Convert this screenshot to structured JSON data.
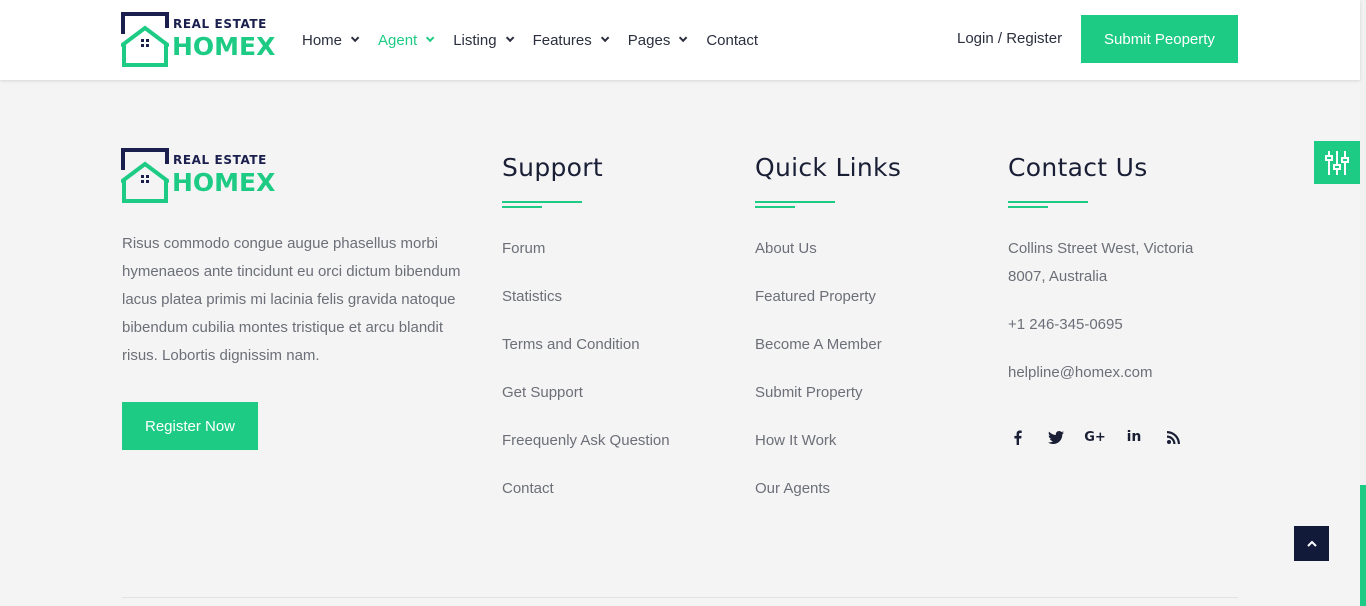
{
  "logo": {
    "brand_top": "REAL ESTATE",
    "brand_main": "HOMEX"
  },
  "nav": {
    "items": [
      {
        "label": "Home"
      },
      {
        "label": "Agent"
      },
      {
        "label": "Listing"
      },
      {
        "label": "Features"
      },
      {
        "label": "Pages"
      },
      {
        "label": "Contact"
      }
    ],
    "login_label": "Login / Register",
    "submit_label": "Submit Peoperty"
  },
  "footer": {
    "about": "Risus commodo congue augue phasellus morbi hymenaeos ante tincidunt eu orci dictum bibendum lacus platea primis mi lacinia felis gravida natoque bibendum cubilia montes tristique et arcu blandit risus. Lobortis dignissim nam.",
    "register_label": "Register Now",
    "support": {
      "title": "Support",
      "links": [
        "Forum",
        "Statistics",
        "Terms and Condition",
        "Get Support",
        "Freequenly Ask Question",
        "Contact"
      ]
    },
    "quick_links": {
      "title": "Quick Links",
      "links": [
        "About Us",
        "Featured Property",
        "Become A Member",
        "Submit Property",
        "How It Work",
        "Our Agents"
      ]
    },
    "contact": {
      "title": "Contact Us",
      "address": "Collins Street West, Victoria 8007, Australia",
      "phone": "+1 246-345-0695",
      "email": "helpline@homex.com"
    },
    "socials": [
      "facebook-icon",
      "twitter-icon",
      "google-plus-icon",
      "linkedin-icon",
      "rss-icon"
    ]
  },
  "colors": {
    "accent": "#1ecb84",
    "navy": "#1a1f4d",
    "dark_button": "#121a3a",
    "text_muted": "#6c6f78"
  }
}
